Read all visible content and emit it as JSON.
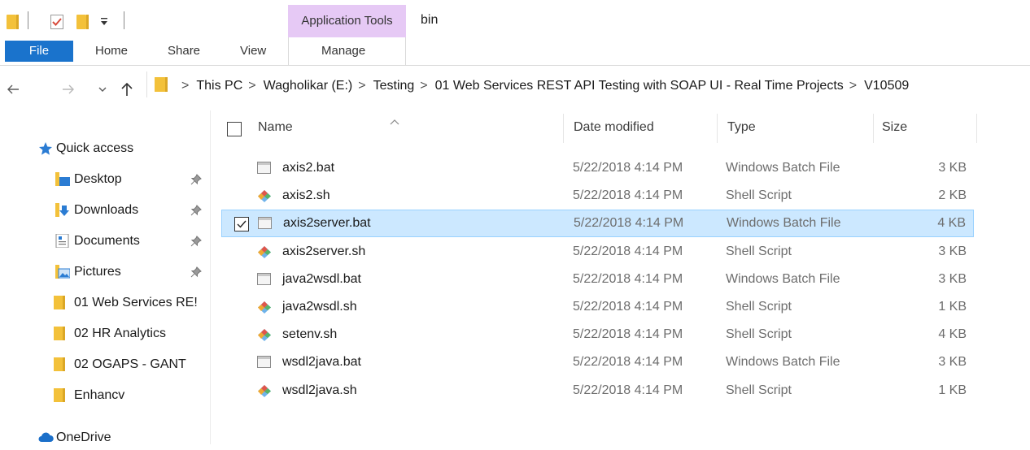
{
  "window": {
    "title": "bin"
  },
  "ribbon": {
    "context_header": "Application Tools",
    "tabs": {
      "file": "File",
      "home": "Home",
      "share": "Share",
      "view": "View",
      "manage": "Manage"
    }
  },
  "address": {
    "crumbs": [
      "This PC",
      "Wagholikar (E:)",
      "Testing",
      "01 Web Services REST API Testing with SOAP UI - Real Time Projects",
      "V10509"
    ]
  },
  "nav": {
    "quick_access": "Quick access",
    "items": [
      {
        "label": "Desktop",
        "icon": "desktop-folder-icon",
        "pinned": true
      },
      {
        "label": "Downloads",
        "icon": "downloads-folder-icon",
        "pinned": true
      },
      {
        "label": "Documents",
        "icon": "documents-folder-icon",
        "pinned": true
      },
      {
        "label": "Pictures",
        "icon": "pictures-folder-icon",
        "pinned": true
      },
      {
        "label": "01 Web Services RE!",
        "icon": "folder-icon",
        "pinned": false
      },
      {
        "label": "02 HR Analytics",
        "icon": "folder-icon",
        "pinned": false
      },
      {
        "label": "02 OGAPS - GANT",
        "icon": "folder-icon",
        "pinned": false
      },
      {
        "label": "Enhancv",
        "icon": "folder-icon",
        "pinned": false
      }
    ],
    "onedrive": "OneDrive"
  },
  "columns": {
    "name": "Name",
    "date": "Date modified",
    "type": "Type",
    "size": "Size"
  },
  "files": [
    {
      "name": "axis2.bat",
      "date": "5/22/2018 4:14 PM",
      "type": "Windows Batch File",
      "size": "3 KB",
      "icon": "batch-file-icon",
      "selected": false
    },
    {
      "name": "axis2.sh",
      "date": "5/22/2018 4:14 PM",
      "type": "Shell Script",
      "size": "2 KB",
      "icon": "shell-script-icon",
      "selected": false
    },
    {
      "name": "axis2server.bat",
      "date": "5/22/2018 4:14 PM",
      "type": "Windows Batch File",
      "size": "4 KB",
      "icon": "batch-file-icon",
      "selected": true
    },
    {
      "name": "axis2server.sh",
      "date": "5/22/2018 4:14 PM",
      "type": "Shell Script",
      "size": "3 KB",
      "icon": "shell-script-icon",
      "selected": false
    },
    {
      "name": "java2wsdl.bat",
      "date": "5/22/2018 4:14 PM",
      "type": "Windows Batch File",
      "size": "3 KB",
      "icon": "batch-file-icon",
      "selected": false
    },
    {
      "name": "java2wsdl.sh",
      "date": "5/22/2018 4:14 PM",
      "type": "Shell Script",
      "size": "1 KB",
      "icon": "shell-script-icon",
      "selected": false
    },
    {
      "name": "setenv.sh",
      "date": "5/22/2018 4:14 PM",
      "type": "Shell Script",
      "size": "4 KB",
      "icon": "shell-script-icon",
      "selected": false
    },
    {
      "name": "wsdl2java.bat",
      "date": "5/22/2018 4:14 PM",
      "type": "Windows Batch File",
      "size": "3 KB",
      "icon": "batch-file-icon",
      "selected": false
    },
    {
      "name": "wsdl2java.sh",
      "date": "5/22/2018 4:14 PM",
      "type": "Shell Script",
      "size": "1 KB",
      "icon": "shell-script-icon",
      "selected": false
    }
  ],
  "colors": {
    "accent": "#1a73cc",
    "context_tab": "#e6c9f5",
    "selection_bg": "#cce8ff",
    "selection_border": "#99d1ff",
    "folder": "#f3c13a"
  }
}
